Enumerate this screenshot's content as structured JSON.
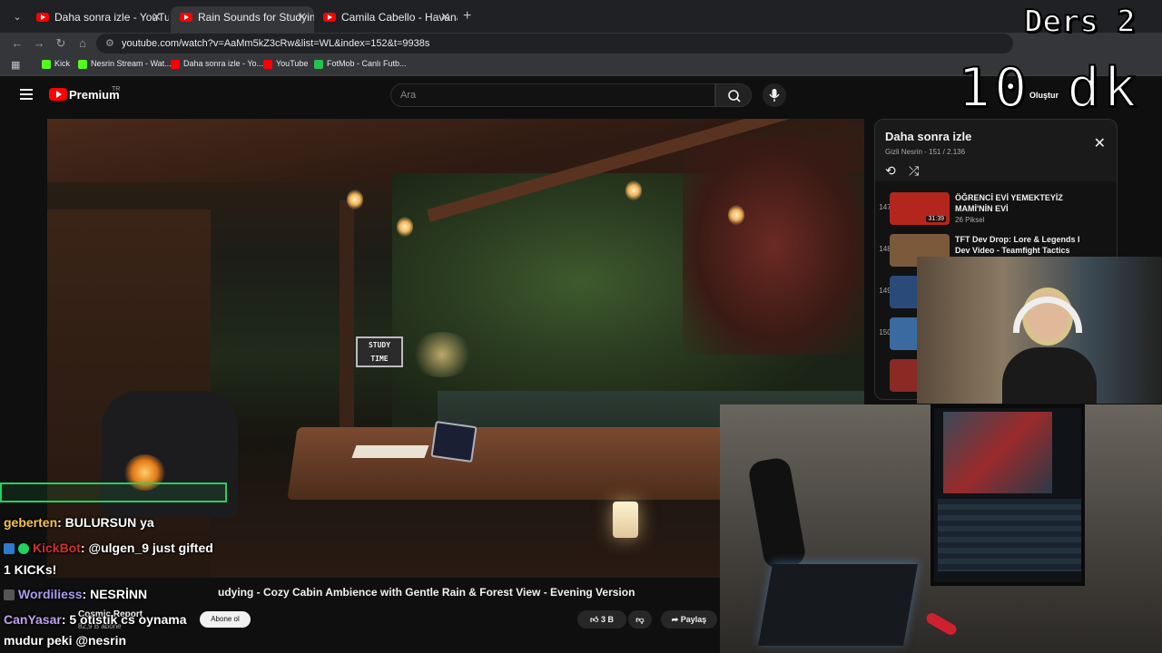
{
  "browser": {
    "tabs": [
      {
        "title": "Daha sonra izle - YouTube"
      },
      {
        "title": "Rain Sounds for Studying - Coz"
      },
      {
        "title": "Camila Cabello - Havana (Lyrics"
      }
    ],
    "url": "youtube.com/watch?v=AaMm5kZ3cRw&list=WL&index=152&t=9938s",
    "bookmarks": [
      {
        "label": "Kick",
        "color": "#53fc18"
      },
      {
        "label": "Nesrin Stream - Wat...",
        "color": "#53fc18"
      },
      {
        "label": "Daha sonra izle - Yo...",
        "color": "#ff0000"
      },
      {
        "label": "YouTube",
        "color": "#ff0000"
      },
      {
        "label": "FotMob - Canlı Futb...",
        "color": "#27c24c"
      }
    ]
  },
  "youtube": {
    "brand": "Premium",
    "region": "TR",
    "search_placeholder": "Ara",
    "create_label": "Oluştur",
    "video_title": "Rain Sounds for Studying - Cozy Cabin Ambience with Gentle Rain & Forest View - Evening Version",
    "video_title_visible": "udying - Cozy Cabin Ambience with Gentle Rain & Forest View - Evening Version",
    "sign_text_1": "STUDY",
    "sign_text_2": "TIME",
    "channel_name": "Cosmic Report",
    "channel_subs": "82,9 B abone",
    "subscribe_label": "Abone ol",
    "like_count": "3 B",
    "share_label": "Paylaş"
  },
  "playlist": {
    "title": "Daha sonra izle",
    "subtitle": "Gizli   Nesrin - 151 / 2.136",
    "items": [
      {
        "index": "147",
        "title": "ÖĞRENCİ EVİ YEMEKTEYİZ MAMİ'NİN EVİ",
        "channel": "26 Piksel",
        "duration": "31:39",
        "thumb": "#b3261e"
      },
      {
        "index": "148",
        "title": "TFT Dev Drop: Lore & Legends I Dev Video - Teamfight Tactics",
        "channel": "",
        "duration": "",
        "thumb": "#7a5a3a"
      },
      {
        "index": "149",
        "title": "",
        "channel": "",
        "duration": "",
        "thumb": "#2a4a7a"
      },
      {
        "index": "150",
        "title": "",
        "channel": "",
        "duration": "",
        "thumb": "#3a6aa0"
      },
      {
        "index": "",
        "title": "",
        "channel": "",
        "duration": "",
        "thumb": "#8a2a22"
      }
    ]
  },
  "overlay": {
    "line1": "Ders 2",
    "line2": "10 dk"
  },
  "chat": {
    "messages": [
      {
        "user": "geberten",
        "text": ": BULURSUN ya",
        "color_class": "u1"
      },
      {
        "user": "KickBot",
        "text": ": @ulgen_9 just gifted",
        "color_class": "u2"
      },
      {
        "user": "",
        "text": "1 KICKs!",
        "color_class": ""
      },
      {
        "user": "Wordiliess",
        "text": ": NESRİNN",
        "color_class": "u3"
      },
      {
        "user": "CanYasar",
        "text": ": 5 otistik cs oynama",
        "color_class": "u4"
      },
      {
        "user": "",
        "text": "mudur peki @nesrin",
        "color_class": ""
      }
    ]
  }
}
